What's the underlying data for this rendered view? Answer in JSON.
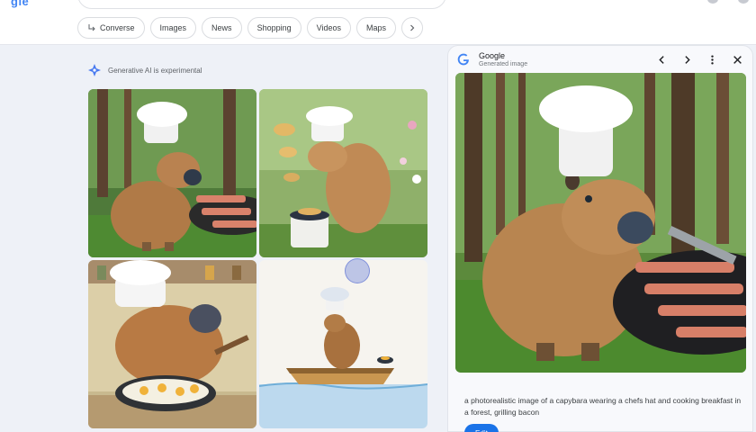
{
  "header": {
    "logo_fragment": "gle",
    "chips": [
      {
        "label": "Converse",
        "icon": "converse-arrow-icon"
      },
      {
        "label": "Images"
      },
      {
        "label": "News"
      },
      {
        "label": "Shopping"
      },
      {
        "label": "Videos"
      },
      {
        "label": "Maps"
      }
    ]
  },
  "results": {
    "gen_label": "Generative AI is experimental",
    "images": [
      {
        "alt": "capybara-chef-grilling-bacon"
      },
      {
        "alt": "capybara-flipping-pancakes"
      },
      {
        "alt": "capybara-frying-eggs"
      },
      {
        "alt": "capybara-in-boat"
      }
    ]
  },
  "panel": {
    "title": "Google",
    "subtitle": "Generated image",
    "caption": "a photorealistic image of a capybara wearing a chefs hat and cooking breakfast in a forest, grilling bacon",
    "edit_label": "Edit"
  },
  "colors": {
    "accent": "#1a73e8",
    "background": "#eef1f7"
  }
}
